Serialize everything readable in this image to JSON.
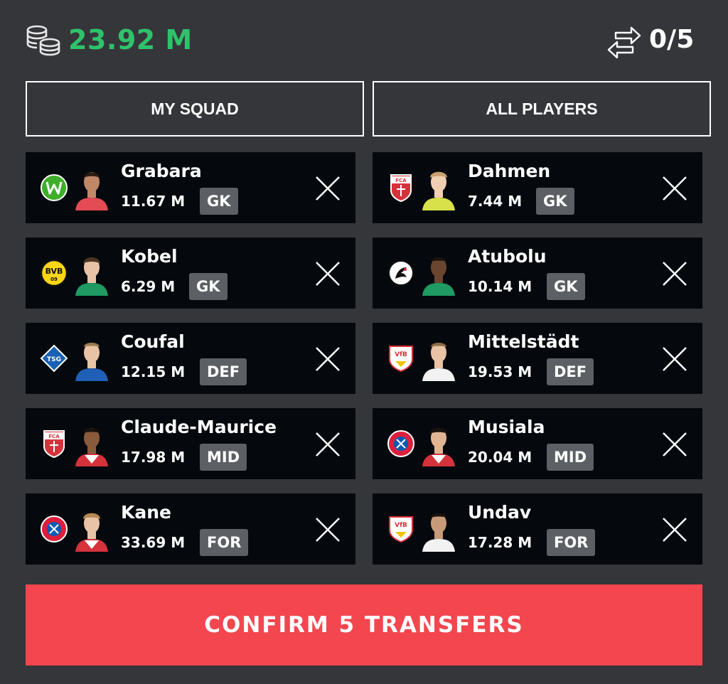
{
  "header": {
    "budget": "23.92 M",
    "budget_icon": "coins-icon",
    "transfers_icon": "swap-arrows-icon",
    "transfers_count": "0/5"
  },
  "tabs": {
    "my_squad": "MY SQUAD",
    "all_players": "ALL PLAYERS"
  },
  "my_squad": [
    {
      "name": "Grabara",
      "price": "11.67 M",
      "position": "GK",
      "club_icon": "wolfsburg-crest-icon",
      "kit_color": "#e34b55",
      "remove_icon": "close-icon"
    },
    {
      "name": "Kobel",
      "price": "6.29 M",
      "position": "GK",
      "club_icon": "dortmund-crest-icon",
      "kit_color": "#1e9a62",
      "remove_icon": "close-icon"
    },
    {
      "name": "Coufal",
      "price": "12.15 M",
      "position": "DEF",
      "club_icon": "hoffenheim-crest-icon",
      "kit_color": "#1f5fb5",
      "remove_icon": "close-icon"
    },
    {
      "name": "Claude-Maurice",
      "price": "17.98 M",
      "position": "MID",
      "club_icon": "augsburg-crest-icon",
      "kit_color": "#d6323c",
      "remove_icon": "close-icon"
    },
    {
      "name": "Kane",
      "price": "33.69 M",
      "position": "FOR",
      "club_icon": "bayern-crest-icon",
      "kit_color": "#d6323c",
      "remove_icon": "close-icon"
    }
  ],
  "all_players": [
    {
      "name": "Dahmen",
      "price": "7.44 M",
      "position": "GK",
      "club_icon": "augsburg-crest-icon",
      "kit_color": "#d8e04a",
      "remove_icon": "close-icon"
    },
    {
      "name": "Atubolu",
      "price": "10.14 M",
      "position": "GK",
      "club_icon": "freiburg-crest-icon",
      "kit_color": "#1e9a62",
      "remove_icon": "close-icon"
    },
    {
      "name": "Mittelstädt",
      "price": "19.53 M",
      "position": "DEF",
      "club_icon": "stuttgart-crest-icon",
      "kit_color": "#f2f2f2",
      "remove_icon": "close-icon"
    },
    {
      "name": "Musiala",
      "price": "20.04 M",
      "position": "MID",
      "club_icon": "bayern-crest-icon",
      "kit_color": "#d6323c",
      "remove_icon": "close-icon"
    },
    {
      "name": "Undav",
      "price": "17.28 M",
      "position": "FOR",
      "club_icon": "stuttgart-crest-icon",
      "kit_color": "#f2f2f2",
      "remove_icon": "close-icon"
    }
  ],
  "confirm_button": "CONFIRM 5 TRANSFERS",
  "colors": {
    "background": "#35363a",
    "card": "#05090d",
    "budget_green": "#2fc26b",
    "confirm_red": "#f3464f",
    "badge_grey": "#5c5f63"
  }
}
